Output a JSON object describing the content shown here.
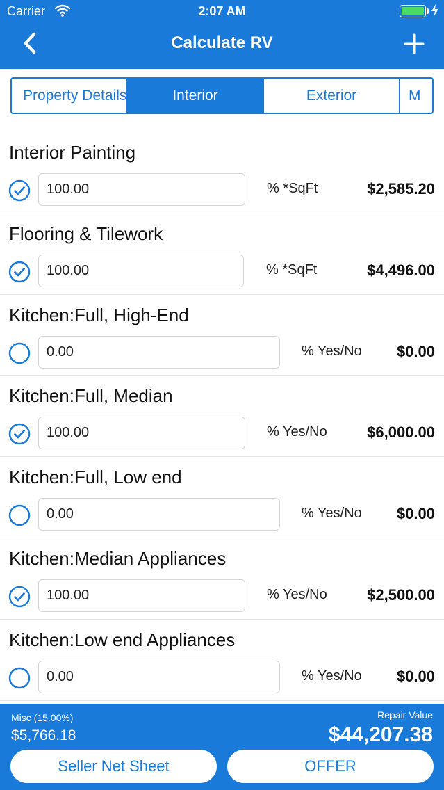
{
  "status_bar": {
    "carrier": "Carrier",
    "time": "2:07 AM"
  },
  "nav": {
    "title": "Calculate RV"
  },
  "tabs": [
    {
      "label": "Property Details"
    },
    {
      "label": "Interior"
    },
    {
      "label": "Exterior"
    },
    {
      "label": "M"
    }
  ],
  "items": [
    {
      "title": "Interior Painting",
      "value": "100.00",
      "unit": "% *SqFt",
      "amount": "$2,585.20",
      "checked": true
    },
    {
      "title": "Flooring & Tilework",
      "value": "100.00",
      "unit": "% *SqFt",
      "amount": "$4,496.00",
      "checked": true
    },
    {
      "title": "Kitchen:Full, High-End",
      "value": "0.00",
      "unit": "% Yes/No",
      "amount": "$0.00",
      "checked": false
    },
    {
      "title": "Kitchen:Full, Median",
      "value": "100.00",
      "unit": "% Yes/No",
      "amount": "$6,000.00",
      "checked": true
    },
    {
      "title": "Kitchen:Full, Low end",
      "value": "0.00",
      "unit": "% Yes/No",
      "amount": "$0.00",
      "checked": false
    },
    {
      "title": "Kitchen:Median Appliances",
      "value": "100.00",
      "unit": "% Yes/No",
      "amount": "$2,500.00",
      "checked": true
    },
    {
      "title": "Kitchen:Low end Appliances",
      "value": "0.00",
      "unit": "% Yes/No",
      "amount": "$0.00",
      "checked": false
    }
  ],
  "footer": {
    "misc_label": "Misc (15.00%)",
    "misc_value": "$5,766.18",
    "repair_label": "Repair Value",
    "repair_value": "$44,207.38",
    "seller_button": "Seller Net Sheet",
    "offer_button": "OFFER"
  },
  "colors": {
    "primary": "#1a7ad9",
    "battery": "#4cd964"
  }
}
